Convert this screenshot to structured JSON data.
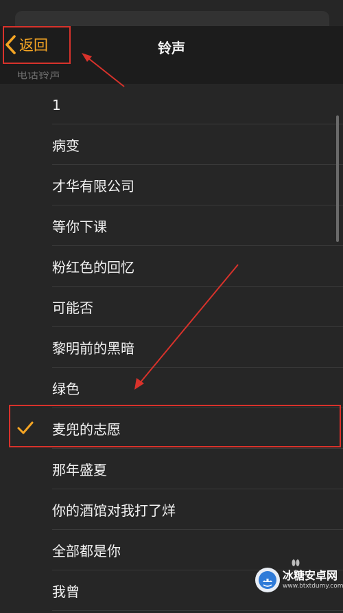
{
  "nav": {
    "back_label": "返回",
    "title": "铃声"
  },
  "section": {
    "header": "电话铃声"
  },
  "ringtones": [
    {
      "label": "1",
      "selected": false
    },
    {
      "label": "病变",
      "selected": false
    },
    {
      "label": "才华有限公司",
      "selected": false
    },
    {
      "label": "等你下课",
      "selected": false
    },
    {
      "label": "粉红色的回忆",
      "selected": false
    },
    {
      "label": "可能否",
      "selected": false
    },
    {
      "label": "黎明前的黑暗",
      "selected": false
    },
    {
      "label": "绿色",
      "selected": false
    },
    {
      "label": "麦兜的志愿",
      "selected": true
    },
    {
      "label": "那年盛夏",
      "selected": false
    },
    {
      "label": "你的酒馆对我打了烊",
      "selected": false
    },
    {
      "label": "全部都是你",
      "selected": false
    },
    {
      "label": "我曾",
      "selected": false
    }
  ],
  "watermark": {
    "title": "冰糖安卓网",
    "url": "www.btxtdumy.com"
  },
  "colors": {
    "background": "#262626",
    "navbar": "#1c1c1c",
    "accent": "#f5a524",
    "annotation": "#d8322b",
    "separator": "#3a3a3a"
  }
}
